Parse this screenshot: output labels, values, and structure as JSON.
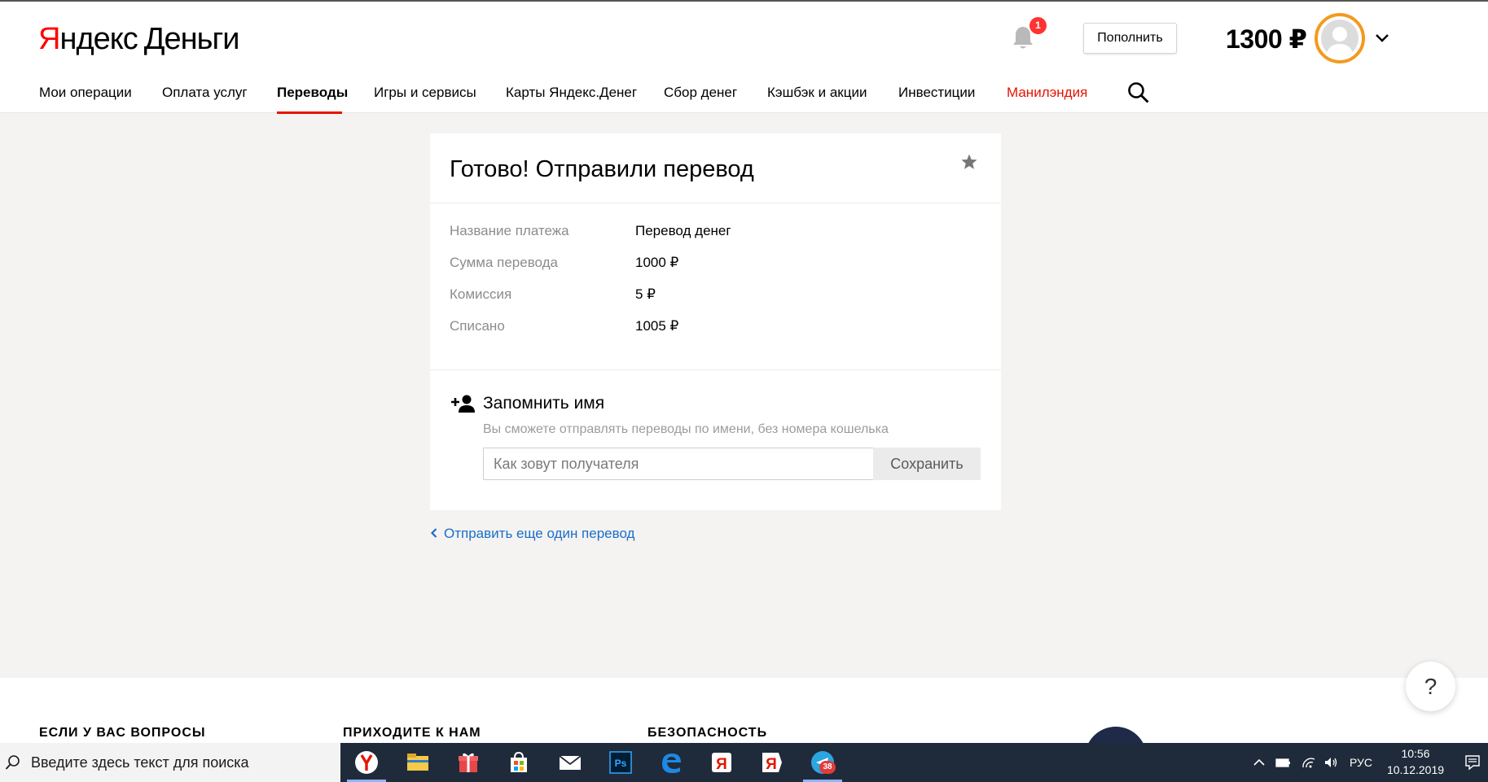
{
  "header": {
    "logo_yandex_y": "Я",
    "logo_yandex_rest": "ндекс",
    "logo_money": "Деньги",
    "notification_count": "1",
    "topup_label": "Пополнить",
    "balance": "1300 ₽"
  },
  "nav": {
    "items": [
      {
        "label": "Мои операции"
      },
      {
        "label": "Оплата услуг"
      },
      {
        "label": "Переводы"
      },
      {
        "label": "Игры и сервисы"
      },
      {
        "label": "Карты Яндекс.Денег"
      },
      {
        "label": "Сбор денег"
      },
      {
        "label": "Кэшбэк и акции"
      },
      {
        "label": "Инвестиции"
      },
      {
        "label": "Манилэндия"
      }
    ],
    "active_index": 2,
    "accent_color": "#e61400"
  },
  "card": {
    "title": "Готово! Отправили перевод",
    "rows": [
      {
        "label": "Название платежа",
        "value": "Перевод денег"
      },
      {
        "label": "Сумма перевода",
        "value": "1000 ₽"
      },
      {
        "label": "Комиссия",
        "value": "5 ₽"
      },
      {
        "label": "Списано",
        "value": "1005 ₽"
      }
    ],
    "remember": {
      "title": "Запомнить имя",
      "hint": "Вы сможете отправлять переводы по имени, без номера кошелька",
      "input_placeholder": "Как зовут получателя",
      "input_value": "",
      "save_label": "Сохранить"
    }
  },
  "back_link": "Отправить еще один перевод",
  "footer": {
    "headings": [
      "ЕСЛИ У ВАС ВОПРОСЫ",
      "ПРИХОДИТЕ К НАМ",
      "БЕЗОПАСНОСТЬ"
    ],
    "help_label": "?"
  },
  "taskbar": {
    "search_text": "Введите здесь текст для поиска",
    "apps": [
      {
        "icon": "yandex-browser-icon"
      },
      {
        "icon": "file-explorer-icon"
      },
      {
        "icon": "gift-icon"
      },
      {
        "icon": "store-icon"
      },
      {
        "icon": "mail-icon"
      },
      {
        "icon": "photoshop-icon"
      },
      {
        "icon": "edge-icon"
      },
      {
        "icon": "yandex-icon"
      },
      {
        "icon": "yandex-red-icon"
      },
      {
        "icon": "telegram-icon"
      }
    ],
    "telegram_badge": "38",
    "language": "РУС",
    "time": "10:56",
    "date": "10.12.2019"
  }
}
